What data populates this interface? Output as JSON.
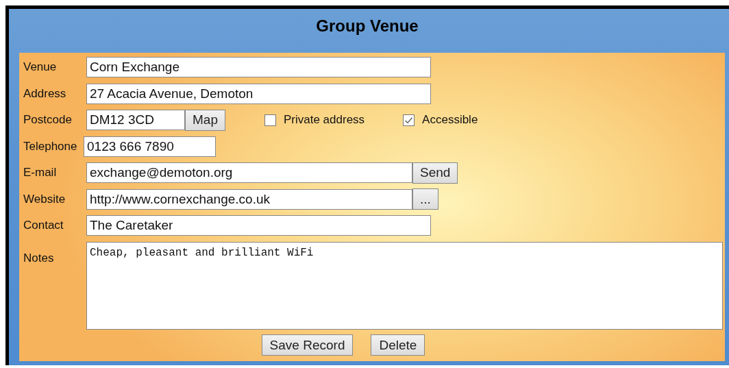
{
  "title": "Group Venue",
  "fields": [
    {
      "label": "Venue",
      "value": "Corn Exchange",
      "kind": "text"
    },
    {
      "label": "Address",
      "value": "27 Acacia Avenue, Demoton",
      "kind": "text"
    },
    {
      "label": "Postcode",
      "value": "DM12 3CD",
      "kind": "text",
      "button": "Map",
      "options": [
        {
          "label": "Private address",
          "checked": false
        },
        {
          "label": "Accessible",
          "checked": true
        }
      ]
    },
    {
      "label": "Telephone",
      "value": "0123 666 7890",
      "kind": "text"
    },
    {
      "label": "E-mail",
      "value": "exchange@demoton.org",
      "kind": "text",
      "button": "Send"
    },
    {
      "label": "Website",
      "value": "http://www.cornexchange.co.uk",
      "kind": "text",
      "button": "..."
    },
    {
      "label": "Contact",
      "value": "The Caretaker",
      "kind": "text"
    },
    {
      "label": "Notes",
      "value": "Cheap, pleasant and brilliant WiFi",
      "kind": "textarea"
    }
  ],
  "buttons": [
    "Save Record",
    "Delete"
  ]
}
